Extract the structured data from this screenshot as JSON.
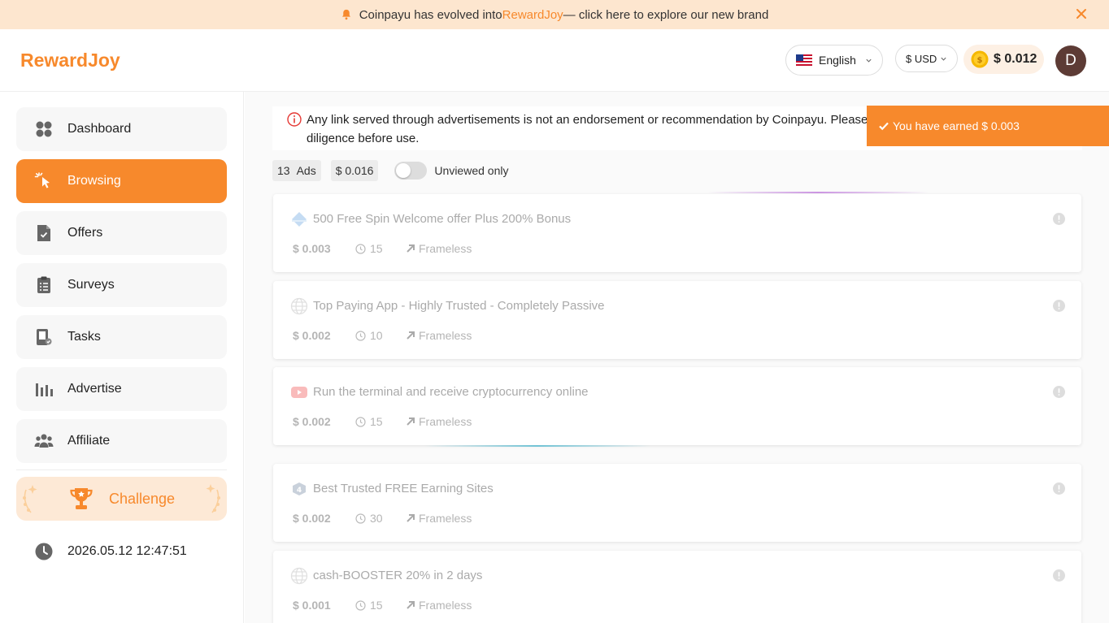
{
  "banner": {
    "text_before": "Coinpayu has evolved into ",
    "brand": "RewardJoy",
    "text_after": " — click here to explore our new brand"
  },
  "header": {
    "logo": "RewardJoy",
    "language": "English",
    "currency": "$ USD",
    "balance": "$ 0.012",
    "avatar_letter": "D"
  },
  "sidebar": {
    "items": [
      {
        "label": "Dashboard"
      },
      {
        "label": "Browsing"
      },
      {
        "label": "Offers"
      },
      {
        "label": "Surveys"
      },
      {
        "label": "Tasks"
      },
      {
        "label": "Advertise"
      },
      {
        "label": "Affiliate"
      }
    ],
    "challenge": "Challenge",
    "datetime": "2026.05.12 12:47:51"
  },
  "notice": {
    "text": "Any link served through advertisements is not an endorsement or recommendation by Coinpayu. Please e",
    "text_line2": "diligence before use."
  },
  "toast": {
    "text": "You have earned $ 0.003"
  },
  "stats": {
    "ads_count": "13",
    "ads_label": "Ads",
    "total": "$ 0.016",
    "toggle_label": "Unviewed only"
  },
  "ads": [
    {
      "title": "500 Free Spin Welcome offer Plus 200% Bonus",
      "price": "$ 0.003",
      "seconds": "15",
      "type": "Frameless",
      "icon": "diamond-icon"
    },
    {
      "title": "Top Paying App - Highly Trusted - Completely Passive",
      "price": "$ 0.002",
      "seconds": "10",
      "type": "Frameless",
      "icon": "globe-icon"
    },
    {
      "title": "Run the terminal and receive cryptocurrency online",
      "price": "$ 0.002",
      "seconds": "15",
      "type": "Frameless",
      "icon": "youtube-icon"
    },
    {
      "title": "Best Trusted FREE Earning Sites",
      "price": "$ 0.002",
      "seconds": "30",
      "type": "Frameless",
      "icon": "app-logo-icon"
    },
    {
      "title": "cash-BOOSTER 20% in 2 days",
      "price": "$ 0.001",
      "seconds": "15",
      "type": "Frameless",
      "icon": "globe-icon"
    }
  ],
  "colors": {
    "accent": "#f7892c",
    "banner_bg": "#fde6cf",
    "avatar_bg": "#5d3b35"
  }
}
